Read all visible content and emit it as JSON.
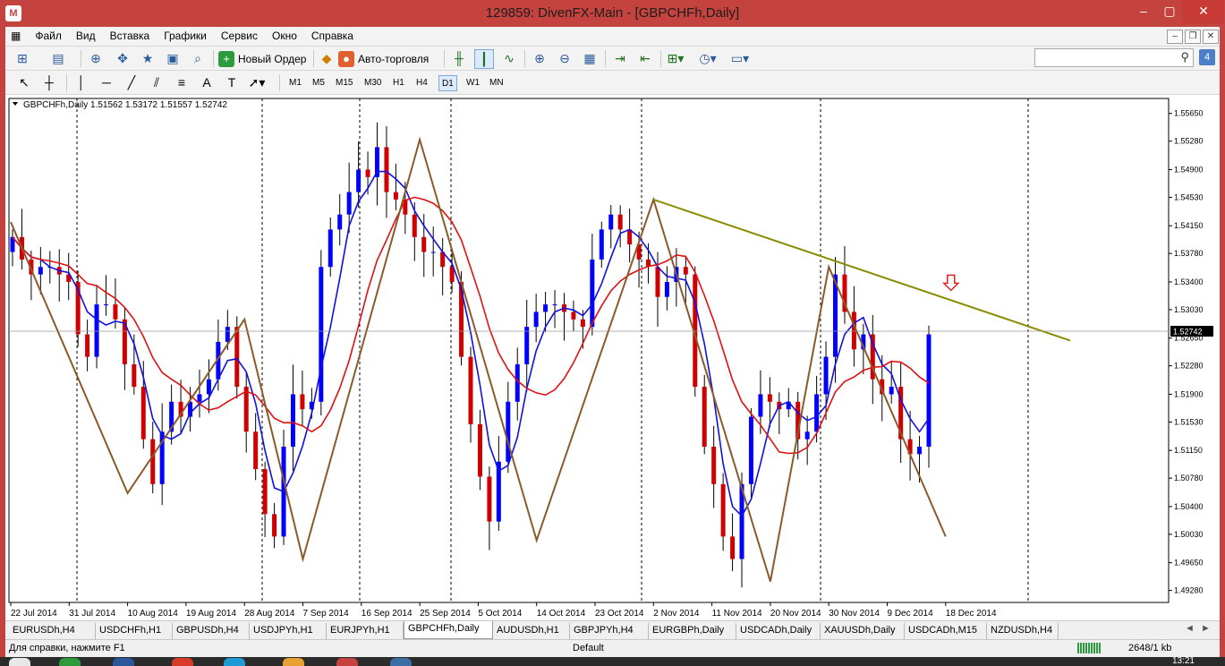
{
  "window": {
    "title": "129859: DivenFX-Main - [GBPCHFh,Daily]",
    "minimize": "–",
    "maximize": "▢",
    "close": "✕"
  },
  "menu": [
    "Файл",
    "Вид",
    "Вставка",
    "Графики",
    "Сервис",
    "Окно",
    "Справка"
  ],
  "toolbar": {
    "new_order": "Новый Ордер",
    "auto_trading": "Авто-торговля",
    "notifications_count": "4"
  },
  "timeframes": [
    "M1",
    "M5",
    "M15",
    "M30",
    "H1",
    "H4",
    "D1",
    "W1",
    "MN"
  ],
  "active_timeframe": "D1",
  "chart": {
    "header": "GBPCHFh,Daily  1.51562 1.53172 1.51557 1.52742",
    "current_price": "1.52742",
    "colors": {
      "bull": "#0000ff",
      "bear": "#d00000",
      "ma_fast": "#1010e0",
      "ma_slow": "#e01010",
      "zigzag": "#8b5a2b",
      "trendline": "#8b8b00",
      "arrow": "#e02020"
    }
  },
  "chart_data": {
    "type": "candlestick",
    "symbol": "GBPCHFh",
    "timeframe": "Daily",
    "ohlc_last": {
      "open": 1.51562,
      "high": 1.53172,
      "low": 1.51557,
      "close": 1.52742
    },
    "price_labels": [
      "1.55650",
      "1.55280",
      "1.54900",
      "1.54530",
      "1.54150",
      "1.53780",
      "1.53400",
      "1.53030",
      "1.52650",
      "1.52280",
      "1.51900",
      "1.51530",
      "1.51150",
      "1.50780",
      "1.50400",
      "1.50030",
      "1.49650",
      "1.49280"
    ],
    "ylim": [
      1.4912,
      1.5585
    ],
    "date_labels": [
      "22 Jul 2014",
      "31 Jul 2014",
      "10 Aug 2014",
      "19 Aug 2014",
      "28 Aug 2014",
      "7 Sep 2014",
      "16 Sep 2014",
      "25 Sep 2014",
      "5 Oct 2014",
      "14 Oct 2014",
      "23 Oct 2014",
      "2 Nov 2014",
      "11 Nov 2014",
      "20 Nov 2014",
      "30 Nov 2014",
      "9 Dec 2014",
      "18 Dec 2014"
    ],
    "close_series": [
      1.54,
      1.537,
      1.535,
      1.536,
      1.536,
      1.535,
      1.534,
      1.527,
      1.524,
      1.531,
      1.531,
      1.529,
      1.523,
      1.52,
      1.513,
      1.507,
      1.514,
      1.518,
      1.516,
      1.518,
      1.519,
      1.521,
      1.526,
      1.528,
      1.52,
      1.514,
      1.509,
      1.503,
      1.5,
      1.512,
      1.519,
      1.517,
      1.518,
      1.536,
      1.541,
      1.543,
      1.546,
      1.549,
      1.548,
      1.552,
      1.546,
      1.545,
      1.543,
      1.54,
      1.538,
      1.538,
      1.536,
      1.534,
      1.524,
      1.515,
      1.508,
      1.502,
      1.51,
      1.518,
      1.523,
      1.528,
      1.53,
      1.531,
      1.531,
      1.53,
      1.529,
      1.528,
      1.537,
      1.541,
      1.543,
      1.541,
      1.539,
      1.537,
      1.536,
      1.532,
      1.534,
      1.536,
      1.535,
      1.52,
      1.512,
      1.507,
      1.5,
      1.497,
      1.507,
      1.516,
      1.519,
      1.518,
      1.517,
      1.518,
      1.513,
      1.514,
      1.519,
      1.524,
      1.535,
      1.53,
      1.525,
      1.527,
      1.521,
      1.519,
      1.52,
      1.513,
      1.511,
      1.512,
      1.527
    ],
    "zigzag": [
      {
        "date": "22 Jul 2014",
        "price": 1.542
      },
      {
        "date": "10 Aug 2014",
        "price": 1.5058
      },
      {
        "date": "28 Aug 2014",
        "price": 1.529
      },
      {
        "date": "7 Sep 2014",
        "price": 1.497
      },
      {
        "date": "25 Sep 2014",
        "price": 1.553
      },
      {
        "date": "14 Oct 2014",
        "price": 1.4995
      },
      {
        "date": "2 Nov 2014",
        "price": 1.545
      },
      {
        "date": "20 Nov 2014",
        "price": 1.494
      },
      {
        "date": "30 Nov 2014",
        "price": 1.536
      },
      {
        "date": "18 Dec 2014",
        "price": 1.5
      }
    ],
    "trendline": [
      {
        "date": "2 Nov 2014",
        "price": 1.545
      },
      {
        "date": "18 Dec 2014",
        "price": 1.5318
      }
    ],
    "grid": false
  },
  "tabs": [
    "EURUSDh,H4",
    "USDCHFh,H1",
    "GBPUSDh,H4",
    "USDJPYh,H1",
    "EURJPYh,H1",
    "GBPCHFh,Daily",
    "AUDUSDh,H1",
    "GBPJPYh,H4",
    "EURGBPh,Daily",
    "USDCADh,Daily",
    "XAUUSDh,Daily",
    "USDCADh,M15",
    "NZDUSDh,H4"
  ],
  "active_tab": "GBPCHFh,Daily",
  "tab_nav": {
    "left": "◄",
    "right": "►"
  },
  "status": {
    "help": "Для справки, нажмите F1",
    "profile": "Default",
    "traffic": "2648/1 kb"
  },
  "taskbar": {
    "clock": "13:21"
  }
}
